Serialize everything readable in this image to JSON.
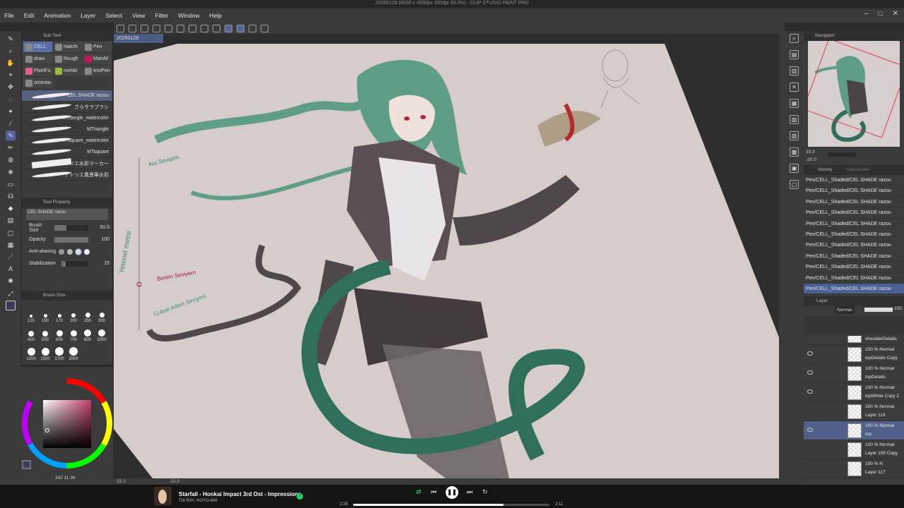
{
  "window": {
    "title": "20260128 (4000 x 4500px 350dpi 33.3%) - CLIP STUDIO PAINT PRO"
  },
  "menu": [
    "File",
    "Edit",
    "Animation",
    "Layer",
    "Select",
    "View",
    "Filter",
    "Window",
    "Help"
  ],
  "window_controls": [
    "–",
    "□",
    "✕"
  ],
  "document_tab": "20260128",
  "subtool": {
    "title": "Sub Tool",
    "groups": [
      [
        {
          "label": "CELL",
          "selected": true
        },
        {
          "label": "Hatchi",
          "selected": false
        },
        {
          "label": "Pen",
          "selected": false
        }
      ],
      [
        {
          "label": "draw",
          "selected": false
        },
        {
          "label": "Rough",
          "selected": false
        },
        {
          "label": "MainM",
          "selected": false
        }
      ],
      [
        {
          "label": "PixelFu",
          "selected": false
        },
        {
          "label": "mehbi",
          "selected": false
        },
        {
          "label": "testPen",
          "selected": false
        }
      ],
      [
        {
          "label": "omenta",
          "selected": false
        }
      ]
    ],
    "brushes": [
      {
        "name": "CEL SHADE razou",
        "selected": true
      },
      {
        "name": "さらサラブラシ",
        "selected": false
      },
      {
        "name": "MTriangle_watercolor",
        "selected": false
      },
      {
        "name": "MTriangle",
        "selected": false
      },
      {
        "name": "MTsquare_watercolor",
        "selected": false
      },
      {
        "name": "MTsquare",
        "selected": false
      },
      {
        "name": "アトリエ水彩マーカー",
        "selected": false
      },
      {
        "name": "アトリエ風景筆水彩",
        "selected": false
      }
    ]
  },
  "tool_property": {
    "title": "Tool Property",
    "preset": "CEL SHADE razou",
    "brush_size_label": "Brush Size",
    "brush_size_value": "50.0",
    "brush_size_fraction": 0.35,
    "opacity_label": "Opacity",
    "opacity_value": "100",
    "opacity_fraction": 1.0,
    "antialias_label": "Anti-aliasing",
    "stabilization_label": "Stabilization",
    "stabilization_value": "15",
    "stabilization_fraction": 0.15
  },
  "brush_size_panel": {
    "title": "Brush Size",
    "sizes": [
      "120",
      "150",
      "170",
      "200",
      "250",
      "300",
      "400",
      "500",
      "600",
      "700",
      "800",
      "1000",
      "1200",
      "1500",
      "1700",
      "2000"
    ]
  },
  "color": {
    "current": "#3a3a5a",
    "hue_box": "#c2406a"
  },
  "color_status": "342 11 36",
  "canvas": {
    "zoom": "33.3",
    "rotation": "-20.0",
    "annotations": {
      "top": "Ata Sevigesi",
      "side": "Yetenel metre",
      "mid": "Benim Seviyem",
      "bottom": "Cubuk Adam Seviyesi"
    }
  },
  "navigator": {
    "title": "Navigator",
    "zoom": "33.3",
    "rotation": "-20.0"
  },
  "history": {
    "title": "History",
    "tab2": "Auto Action",
    "entries": [
      {
        "text": "Pen/CELL_Shaded/CEL SHADE razou",
        "selected": false
      },
      {
        "text": "Pen/CELL_Shaded/CEL SHADE razou",
        "selected": false
      },
      {
        "text": "Pen/CELL_Shaded/CEL SHADE razou",
        "selected": false
      },
      {
        "text": "Pen/CELL_Shaded/CEL SHADE razou",
        "selected": false
      },
      {
        "text": "Pen/CELL_Shaded/CEL SHADE razou",
        "selected": false
      },
      {
        "text": "Pen/CELL_Shaded/CEL SHADE razou",
        "selected": false
      },
      {
        "text": "Pen/CELL_Shaded/CEL SHADE razou",
        "selected": false
      },
      {
        "text": "Pen/CELL_Shaded/CEL SHADE razou",
        "selected": false
      },
      {
        "text": "Pen/CELL_Shaded/CEL SHADE razou",
        "selected": false
      },
      {
        "text": "Pen/CELL_Shaded/CEL SHADE razou",
        "selected": false
      },
      {
        "text": "Pen/CELL_Shaded/CEL SHADE razou",
        "selected": true
      }
    ]
  },
  "layer_panel": {
    "title": "Layer",
    "blend_mode": "Normal",
    "opacity": "100",
    "layers": [
      {
        "mode": "",
        "name": "shoulderDetails",
        "visible": false,
        "selected": false
      },
      {
        "mode": "100 % Normal",
        "name": "topDetails Copy",
        "visible": true,
        "selected": false
      },
      {
        "mode": "100 % Normal",
        "name": "topDetails",
        "visible": true,
        "selected": false
      },
      {
        "mode": "100 % Normal",
        "name": "topWhite Copy 2",
        "visible": true,
        "selected": false
      },
      {
        "mode": "100 % Normal",
        "name": "Layer 119",
        "visible": false,
        "selected": false
      },
      {
        "mode": "100 % Normal",
        "name": "top",
        "visible": true,
        "selected": true
      },
      {
        "mode": "100 % Normal",
        "name": "Layer 109 Copy",
        "visible": false,
        "selected": false
      },
      {
        "mode": "100 % N",
        "name": "Layer 117",
        "visible": false,
        "selected": false
      }
    ]
  },
  "player": {
    "title": "Starfall - Honkai Impact 3rd Ost - Impressions",
    "artist": "TIA RAY, HOYO-MiX",
    "elapsed": "2:26",
    "total": "3:11",
    "progress": 0.7644
  }
}
